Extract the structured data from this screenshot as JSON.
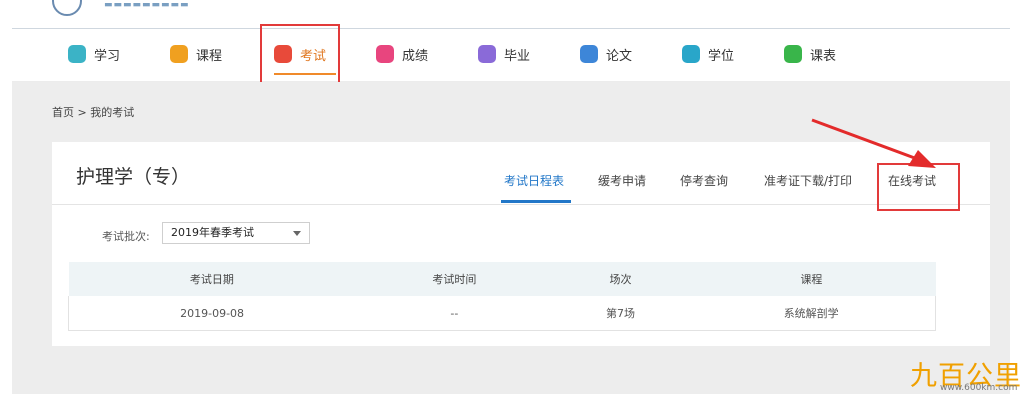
{
  "nav": {
    "items": [
      {
        "label": "学习",
        "color": "#3bb3c6"
      },
      {
        "label": "课程",
        "color": "#f0a020"
      },
      {
        "label": "考试",
        "color": "#e84a3a"
      },
      {
        "label": "成绩",
        "color": "#e8457e"
      },
      {
        "label": "毕业",
        "color": "#8a6ad8"
      },
      {
        "label": "论文",
        "color": "#3d86d8"
      },
      {
        "label": "学位",
        "color": "#29a6c9"
      },
      {
        "label": "课表",
        "color": "#39b54a"
      }
    ],
    "active_index": 2
  },
  "breadcrumb": "首页 > 我的考试",
  "card": {
    "title": "护理学（专）",
    "tabs": [
      "考试日程表",
      "缓考申请",
      "停考查询",
      "准考证下载/打印",
      "在线考试"
    ],
    "active_tab": 0
  },
  "filter": {
    "label": "考试批次:",
    "selected": "2019年春季考试"
  },
  "table": {
    "headers": [
      "考试日期",
      "考试时间",
      "场次",
      "课程"
    ],
    "rows": [
      [
        "2019-09-08",
        "--",
        "第7场",
        "系统解剖学"
      ]
    ]
  },
  "annotations": {
    "highlight_color": "#e23a3a"
  },
  "watermark": {
    "text": "九百公里",
    "url": "www.600km.com"
  }
}
